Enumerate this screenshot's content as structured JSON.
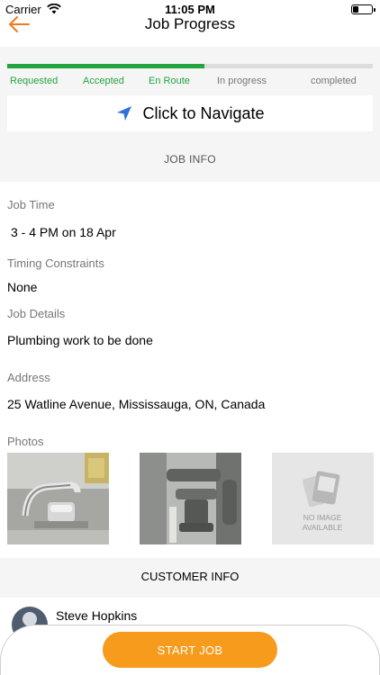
{
  "status_bar": {
    "carrier": "Carrier",
    "time": "11:05 PM"
  },
  "header": {
    "title": "Job Progress"
  },
  "progress": {
    "value": 0.54,
    "steps": [
      {
        "label": "Requested",
        "done": true
      },
      {
        "label": "Accepted",
        "done": true
      },
      {
        "label": "En Route",
        "done": true
      },
      {
        "label": "In progress",
        "done": false
      },
      {
        "label": "completed",
        "done": false
      }
    ]
  },
  "navigate": {
    "label": "Click to Navigate"
  },
  "job_info": {
    "header": "JOB INFO",
    "job_time_label": "Job Time",
    "job_time_value": "3 - 4 PM on 18 Apr",
    "timing_label": "Timing Constraints",
    "timing_value": "None",
    "details_label": "Job Details",
    "details_value": "Plumbing work to be done",
    "address_label": "Address",
    "address_value": "25 Watline Avenue, Mississauga, ON, Canada",
    "photos_label": "Photos",
    "no_image_line1": "NO IMAGE",
    "no_image_line2": "AVAILABLE"
  },
  "customer_info": {
    "header": "CUSTOMER INFO",
    "name": "Steve Hopkins"
  },
  "actions": {
    "start_job": "START JOB"
  },
  "colors": {
    "accent": "#f79b1c",
    "progress_done": "#22a53e",
    "navigate_icon": "#2f6fe0"
  }
}
